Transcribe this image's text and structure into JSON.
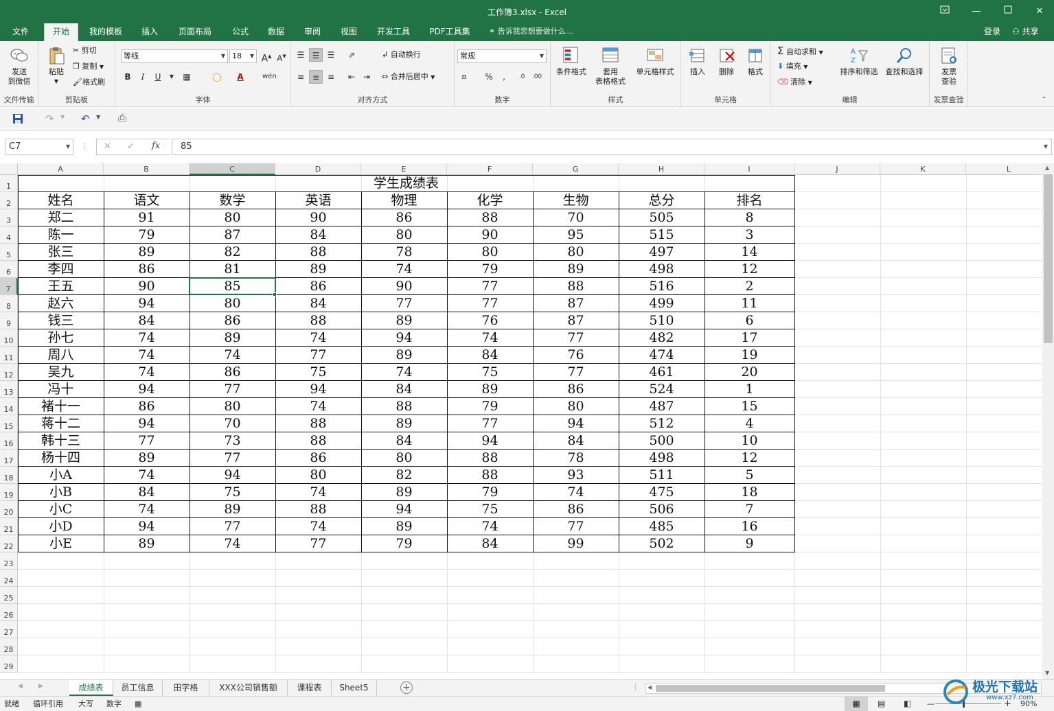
{
  "window": {
    "title": "工作簿3.xlsx - Excel"
  },
  "ribbon_tabs": [
    "文件",
    "开始",
    "我的模板",
    "插入",
    "页面布局",
    "公式",
    "数据",
    "审阅",
    "视图",
    "开发工具",
    "PDF工具集"
  ],
  "active_tab": "开始",
  "tell_me": "告诉我您想要做什么...",
  "account": {
    "login": "登录",
    "share": "共享"
  },
  "ribbon": {
    "wechat": {
      "send": "发送",
      "to_wechat": "到微信",
      "group": "文件传输"
    },
    "clipboard": {
      "paste": "粘贴",
      "cut": "剪切",
      "copy": "复制",
      "painter": "格式刷",
      "group": "剪贴板"
    },
    "font": {
      "name": "等线",
      "size": "18",
      "group": "字体"
    },
    "alignment": {
      "wrap": "自动换行",
      "merge": "合并后居中",
      "group": "对齐方式"
    },
    "number": {
      "format": "常规",
      "group": "数字"
    },
    "styles": {
      "cond": "条件格式",
      "table_1": "套用",
      "table_2": "表格格式",
      "cell_styles": "单元格样式",
      "group": "样式"
    },
    "cells": {
      "insert": "插入",
      "delete": "删除",
      "format": "格式",
      "group": "单元格"
    },
    "editing": {
      "autosum": "自动求和",
      "fill": "填充",
      "clear": "清除",
      "sort": "排序和筛选",
      "find": "查找和选择",
      "group": "编辑"
    },
    "invoice": {
      "l1": "发票",
      "l2": "查验",
      "group": "发票查验"
    }
  },
  "formula_bar": {
    "name_box": "C7",
    "value": "85"
  },
  "columns": [
    "A",
    "B",
    "C",
    "D",
    "E",
    "F",
    "G",
    "H",
    "I",
    "J",
    "K",
    "L"
  ],
  "rows": [
    "1",
    "2",
    "3",
    "4",
    "5",
    "6",
    "7",
    "8",
    "9",
    "10",
    "11",
    "12",
    "13",
    "14",
    "15",
    "16",
    "17",
    "18",
    "19",
    "20",
    "21",
    "22",
    "23",
    "24",
    "25",
    "26",
    "27",
    "28",
    "29"
  ],
  "table": {
    "title": "学生成绩表",
    "headers": [
      "姓名",
      "语文",
      "数学",
      "英语",
      "物理",
      "化学",
      "生物",
      "总分",
      "排名"
    ],
    "rows": [
      [
        "郑二",
        "91",
        "80",
        "90",
        "86",
        "88",
        "70",
        "505",
        "8"
      ],
      [
        "陈一",
        "79",
        "87",
        "84",
        "80",
        "90",
        "95",
        "515",
        "3"
      ],
      [
        "张三",
        "89",
        "82",
        "88",
        "78",
        "80",
        "80",
        "497",
        "14"
      ],
      [
        "李四",
        "86",
        "81",
        "89",
        "74",
        "79",
        "89",
        "498",
        "12"
      ],
      [
        "王五",
        "90",
        "85",
        "86",
        "90",
        "77",
        "88",
        "516",
        "2"
      ],
      [
        "赵六",
        "94",
        "80",
        "84",
        "77",
        "77",
        "87",
        "499",
        "11"
      ],
      [
        "钱三",
        "84",
        "86",
        "88",
        "89",
        "76",
        "87",
        "510",
        "6"
      ],
      [
        "孙七",
        "74",
        "89",
        "74",
        "94",
        "74",
        "77",
        "482",
        "17"
      ],
      [
        "周八",
        "74",
        "74",
        "77",
        "89",
        "84",
        "76",
        "474",
        "19"
      ],
      [
        "吴九",
        "74",
        "86",
        "75",
        "74",
        "75",
        "77",
        "461",
        "20"
      ],
      [
        "冯十",
        "94",
        "77",
        "94",
        "84",
        "89",
        "86",
        "524",
        "1"
      ],
      [
        "褚十一",
        "86",
        "80",
        "74",
        "88",
        "79",
        "80",
        "487",
        "15"
      ],
      [
        "蒋十二",
        "94",
        "70",
        "88",
        "89",
        "77",
        "94",
        "512",
        "4"
      ],
      [
        "韩十三",
        "77",
        "73",
        "88",
        "84",
        "94",
        "84",
        "500",
        "10"
      ],
      [
        "杨十四",
        "89",
        "77",
        "86",
        "80",
        "88",
        "78",
        "498",
        "12"
      ],
      [
        "小A",
        "74",
        "94",
        "80",
        "82",
        "88",
        "93",
        "511",
        "5"
      ],
      [
        "小B",
        "84",
        "75",
        "74",
        "89",
        "79",
        "74",
        "475",
        "18"
      ],
      [
        "小C",
        "74",
        "89",
        "88",
        "94",
        "75",
        "86",
        "506",
        "7"
      ],
      [
        "小D",
        "94",
        "77",
        "74",
        "89",
        "74",
        "77",
        "485",
        "16"
      ],
      [
        "小E",
        "89",
        "74",
        "77",
        "79",
        "84",
        "99",
        "502",
        "9"
      ]
    ]
  },
  "sheets": [
    "成绩表",
    "员工信息",
    "田字格",
    "XXX公司销售额",
    "课程表",
    "Sheet5"
  ],
  "active_sheet": "成绩表",
  "status": {
    "ready": "就绪",
    "circular": "循环引用",
    "caps": "大写",
    "num": "数字",
    "zoom": "90%"
  },
  "watermark": {
    "name": "极光下载站",
    "url": "www.xz7.com"
  },
  "colors": {
    "excel_green": "#217346"
  }
}
